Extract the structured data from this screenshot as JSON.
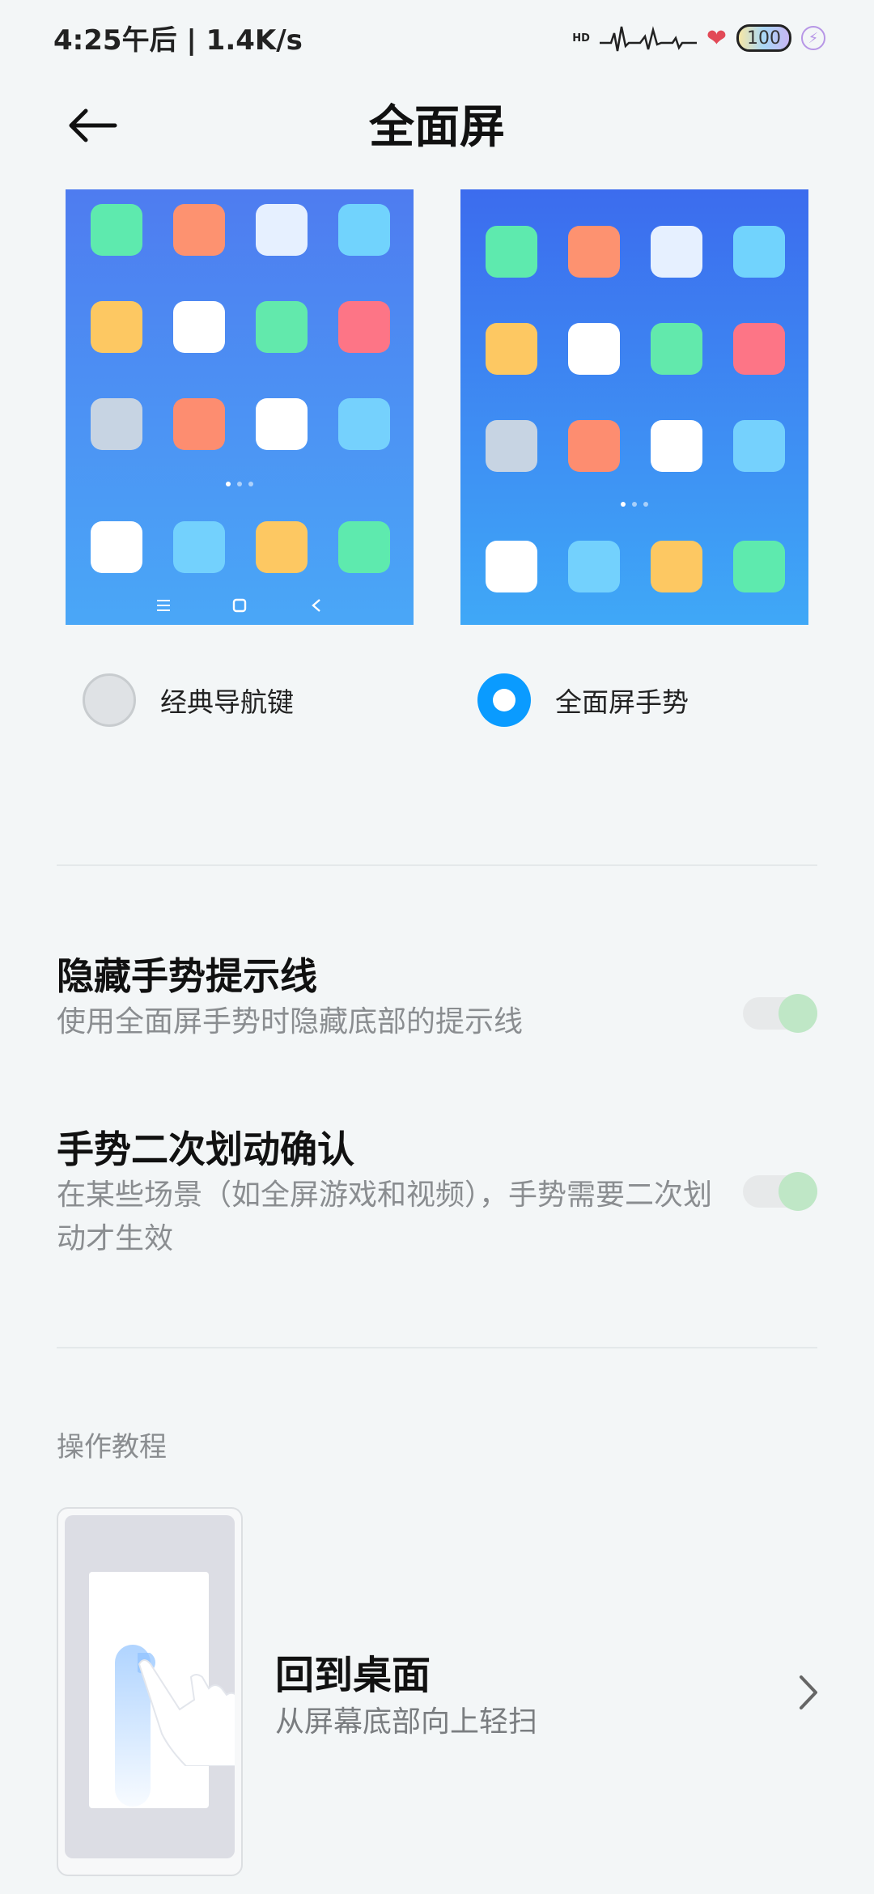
{
  "status_bar": {
    "time": "4:25午后 | 1.4K/s",
    "hd_label": "HD",
    "battery_level": "100",
    "icons": [
      "heartbeat-icon",
      "heart-icon",
      "battery-icon",
      "charging-icon"
    ]
  },
  "header": {
    "title": "全面屏",
    "back_icon": "back-arrow-icon"
  },
  "nav_modes": {
    "options": [
      {
        "label": "经典导航键",
        "selected": false
      },
      {
        "label": "全面屏手势",
        "selected": true
      }
    ],
    "app_colors": [
      "#5eeaae",
      "#fd9270",
      "#e6f0ff",
      "#71d3fd",
      "#fdc862",
      "#ffffff",
      "#62e9ac",
      "#fd7586",
      "#c7d4e3",
      "#fd8d70",
      "#ffffff",
      "#75d1fd"
    ],
    "dock_colors": [
      "#ffffff",
      "#73d1fd",
      "#fdc862",
      "#5eeaae"
    ]
  },
  "settings": [
    {
      "title": "隐藏手势提示线",
      "desc": "使用全面屏手势时隐藏底部的提示线",
      "toggle": "on"
    },
    {
      "title": "手势二次划动确认",
      "desc": "在某些场景（如全屏游戏和视频），手势需要二次划动才生效",
      "toggle": "on"
    }
  ],
  "tutorial": {
    "section_label": "操作教程",
    "items": [
      {
        "title": "回到桌面",
        "desc": "从屏幕底部向上轻扫",
        "icon": "chevron-right-icon"
      }
    ]
  },
  "colors": {
    "accent": "#0a9bff",
    "background": "#f3f6f7",
    "toggle_knob": "#bfe7c6"
  }
}
